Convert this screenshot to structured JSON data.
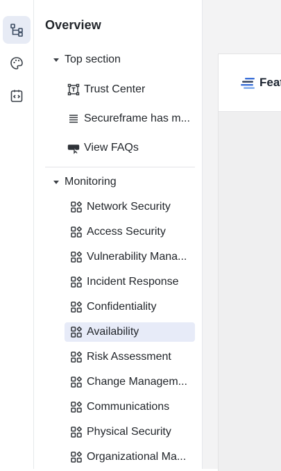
{
  "rail": {
    "items": [
      {
        "icon": "structure-icon",
        "active": true
      },
      {
        "icon": "palette-icon",
        "active": false
      },
      {
        "icon": "code-icon",
        "active": false
      }
    ]
  },
  "panel": {
    "title": "Overview",
    "top_section": {
      "label": "Top section",
      "items": [
        {
          "label": "Trust Center",
          "icon": "text-frame-icon"
        },
        {
          "label": "Secureframe has m...",
          "icon": "lines-icon"
        },
        {
          "label": "View FAQs",
          "icon": "button-icon"
        }
      ]
    },
    "monitoring": {
      "label": "Monitoring",
      "items": [
        {
          "label": "Network Security",
          "icon": "component-icon"
        },
        {
          "label": "Access Security",
          "icon": "component-icon"
        },
        {
          "label": "Vulnerability Mana...",
          "icon": "component-icon"
        },
        {
          "label": "Incident Response",
          "icon": "component-icon"
        },
        {
          "label": "Confidentiality",
          "icon": "component-icon"
        },
        {
          "label": "Availability",
          "icon": "component-icon",
          "selected": true
        },
        {
          "label": "Risk Assessment",
          "icon": "component-icon"
        },
        {
          "label": "Change Managem...",
          "icon": "component-icon"
        },
        {
          "label": "Communications",
          "icon": "component-icon"
        },
        {
          "label": "Physical Security",
          "icon": "component-icon"
        },
        {
          "label": "Organizational Ma...",
          "icon": "component-icon"
        }
      ]
    }
  },
  "preview": {
    "logo_text": "Feat"
  },
  "colors": {
    "selected_bg": "#e7ebf8",
    "rail_active_bg": "#e7ebf5",
    "logo_blue": "#3a6fd8",
    "canvas_bg": "#f3f3f4"
  }
}
